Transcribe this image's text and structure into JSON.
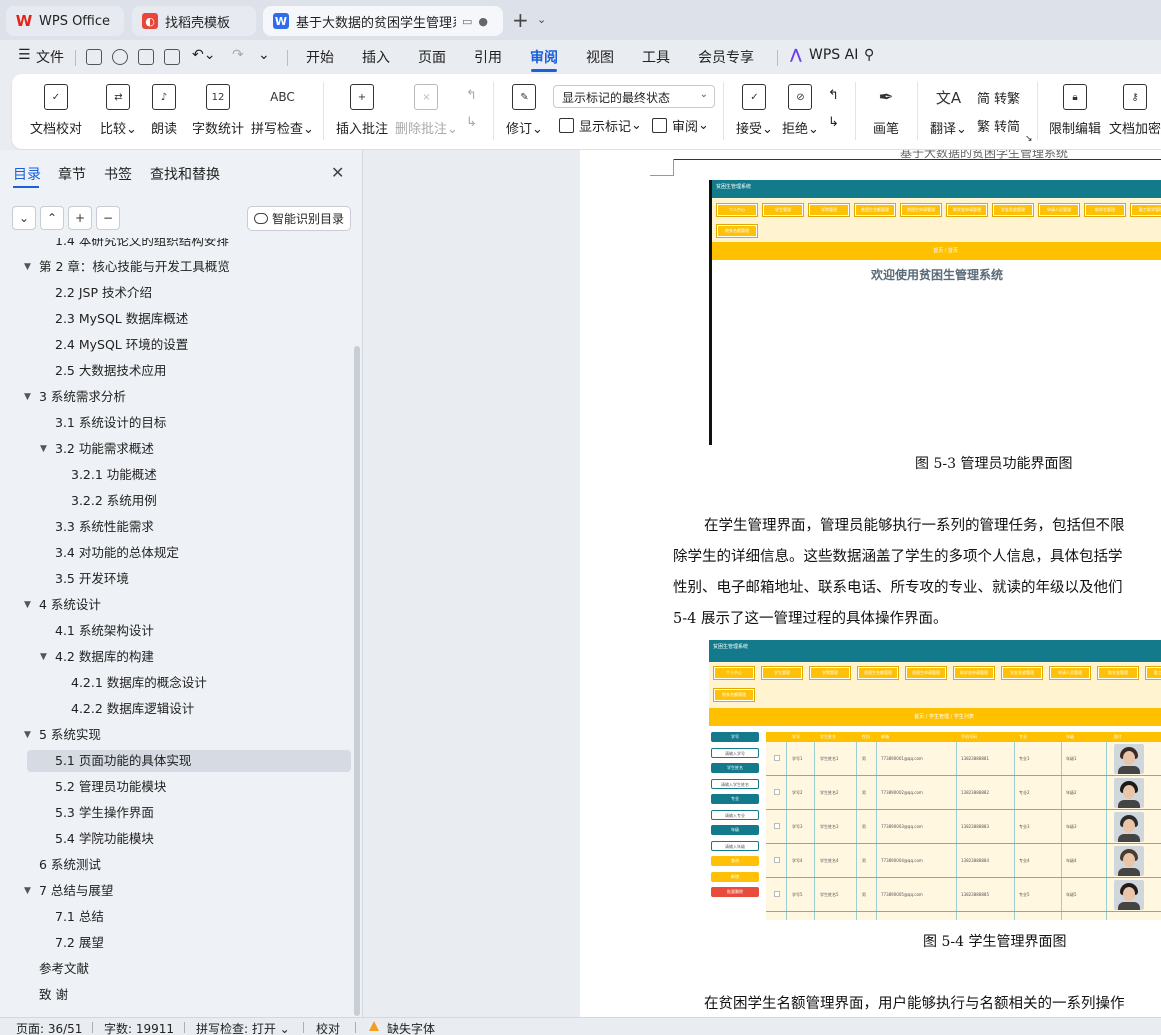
{
  "tabs": [
    {
      "label": "WPS Office",
      "icon": "wps-logo-icon"
    },
    {
      "label": "找稻壳模板",
      "icon": "docer-template-icon"
    },
    {
      "label": "基于大数据的贫困学生管理系统",
      "icon": "writer-doc-icon"
    }
  ],
  "menu": {
    "file": "文件",
    "items": [
      "开始",
      "插入",
      "页面",
      "引用",
      "审阅",
      "视图",
      "工具",
      "会员专享"
    ],
    "active": "审阅",
    "ai": "WPS AI"
  },
  "ribbon": {
    "proofread": "文档校对",
    "compare": "比较",
    "read_aloud": "朗读",
    "word_count": "字数统计",
    "word_count_icon_text": "12",
    "spell_check": "拼写检查",
    "spell_icon_text": "ABC",
    "insert_comment": "插入批注",
    "delete_comment": "删除批注",
    "track_changes": "修订",
    "markup_state": "显示标记的最终状态",
    "show_markup": "显示标记",
    "review": "审阅",
    "accept": "接受",
    "reject": "拒绝",
    "ink": "画笔",
    "translate": "翻译",
    "to_traditional": "转繁",
    "to_simplified": "转简",
    "restrict_editing": "限制编辑",
    "encrypt": "文档加密"
  },
  "nav": {
    "tabs": [
      "目录",
      "章节",
      "书签",
      "查找和替换"
    ],
    "active_tab": "目录",
    "smart_toc": "智能识别目录",
    "toc": [
      {
        "label": "1.4 本研究论文的组织结构安排",
        "level": 2,
        "arrow": ""
      },
      {
        "label": "第 2 章：核心技能与开发工具概览",
        "level": 1,
        "arrow": "down"
      },
      {
        "label": "2.2 JSP 技术介绍",
        "level": 2,
        "arrow": ""
      },
      {
        "label": "2.3 MySQL  数据库概述",
        "level": 2,
        "arrow": ""
      },
      {
        "label": "2.4 MySQL 环境的设置",
        "level": 2,
        "arrow": ""
      },
      {
        "label": "2.5 大数据技术应用",
        "level": 2,
        "arrow": ""
      },
      {
        "label": "3 系统需求分析",
        "level": 1,
        "arrow": "down"
      },
      {
        "label": "3.1 系统设计的目标",
        "level": 2,
        "arrow": ""
      },
      {
        "label": "3.2  功能需求概述",
        "level": 2,
        "arrow": "down"
      },
      {
        "label": "3.2.1  功能概述",
        "level": 3,
        "arrow": ""
      },
      {
        "label": "3.2.2  系统用例",
        "level": 3,
        "arrow": ""
      },
      {
        "label": "3.3 系统性能需求",
        "level": 2,
        "arrow": ""
      },
      {
        "label": "3.4 对功能的总体规定",
        "level": 2,
        "arrow": ""
      },
      {
        "label": "3.5  开发环境",
        "level": 2,
        "arrow": ""
      },
      {
        "label": "4 系统设计",
        "level": 1,
        "arrow": "down"
      },
      {
        "label": "4.1  系统架构设计",
        "level": 2,
        "arrow": ""
      },
      {
        "label": "4.2  数据库的构建",
        "level": 2,
        "arrow": "down"
      },
      {
        "label": "4.2.1  数据库的概念设计",
        "level": 3,
        "arrow": ""
      },
      {
        "label": "4.2.2  数据库逻辑设计",
        "level": 3,
        "arrow": ""
      },
      {
        "label": "5 系统实现",
        "level": 1,
        "arrow": "down"
      },
      {
        "label": "5.1  页面功能的具体实现",
        "level": 2,
        "arrow": "",
        "selected": true
      },
      {
        "label": "5.2 管理员功能模块",
        "level": 2,
        "arrow": ""
      },
      {
        "label": "5.3  学生操作界面",
        "level": 2,
        "arrow": ""
      },
      {
        "label": "5.4  学院功能模块",
        "level": 2,
        "arrow": ""
      },
      {
        "label": "6 系统测试",
        "level": 1,
        "arrow": ""
      },
      {
        "label": "7 总结与展望",
        "level": 1,
        "arrow": "down"
      },
      {
        "label": "7.1  总结",
        "level": 2,
        "arrow": ""
      },
      {
        "label": "7.2  展望",
        "level": 2,
        "arrow": ""
      },
      {
        "label": "参考文献",
        "level": 1,
        "arrow": ""
      },
      {
        "label": "致      谢",
        "level": 1,
        "arrow": ""
      }
    ]
  },
  "document": {
    "header": "基于大数据的贫困学生管理系统",
    "fig1": {
      "app_title": "贫困生管理系统",
      "buttons": [
        "个人中心",
        "学生管理",
        "学院管理",
        "贫困生名额管理",
        "贫困生申请管理",
        "助学金申请管理",
        "学金发放管理",
        "申请人员管理",
        "助学金管理",
        "勤工助学管理",
        "院系名额管理"
      ],
      "breadcrumb": "首页  /  首页",
      "welcome": "欢迎使用贫困生管理系统"
    },
    "caption1": "图 5-3 管理员功能界面图",
    "para_lines": [
      "在学生管理界面，管理员能够执行一系列的管理任务，包括但不限",
      "除学生的详细信息。这些数据涵盖了学生的多项个人信息，具体包括学",
      "性别、电子邮箱地址、联系电话、所专攻的专业、就读的年级以及他们",
      "5-4 展示了这一管理过程的具体操作界面。"
    ],
    "fig2": {
      "app_title": "贫困生管理系统",
      "breadcrumb": "首页  /  学生管理  /  学生列表",
      "side": [
        "学号",
        "请输入学号",
        "学生姓名",
        "请输入学生姓名",
        "专业",
        "请输入专业",
        "年级",
        "请输入年级",
        "查询",
        "新增",
        "批量删除"
      ],
      "columns": [
        "",
        "学号",
        "学生姓名",
        "性别",
        "邮箱",
        "手机号码",
        "专业",
        "年级",
        "照片"
      ],
      "rows": [
        [
          "",
          "学号1",
          "学生姓名1",
          "男",
          "773890001@qq.com",
          "13823888881",
          "专业1",
          "年级1"
        ],
        [
          "",
          "学号2",
          "学生姓名2",
          "男",
          "773890002@qq.com",
          "13823888882",
          "专业2",
          "年级2"
        ],
        [
          "",
          "学号3",
          "学生姓名3",
          "男",
          "773890003@qq.com",
          "13823888883",
          "专业3",
          "年级3"
        ],
        [
          "",
          "学号4",
          "学生姓名4",
          "男",
          "773890004@qq.com",
          "13823888884",
          "专业4",
          "年级4"
        ],
        [
          "",
          "学号5",
          "学生姓名5",
          "男",
          "773890005@qq.com",
          "13823888885",
          "专业5",
          "年级5"
        ]
      ]
    },
    "caption2": "图 5-4 学生管理界面图",
    "para2": "在贫困学生名额管理界面，用户能够执行与名额相关的一系列操作"
  },
  "status": {
    "page": "页面: 36/51",
    "words": "字数: 19911",
    "spell": "拼写检查: 打开",
    "proof": "校对",
    "missing_font": "缺失字体"
  },
  "colors": {
    "accent": "#1a5fdb",
    "app_teal": "#127a8a",
    "app_gold": "#ffc000"
  }
}
